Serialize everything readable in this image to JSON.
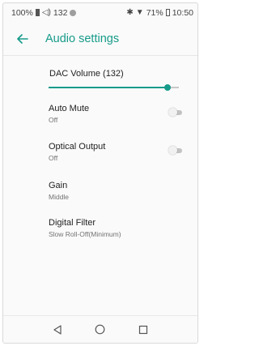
{
  "status_bar": {
    "battery_percent": "100%",
    "volume_value": "132",
    "battery_right": "71%",
    "time": "10:50",
    "icons": [
      "battery-icon",
      "speaker-icon",
      "circle-icon",
      "bluetooth-icon",
      "wifi-icon",
      "battery-icon"
    ]
  },
  "app_bar": {
    "back_icon": "arrow-left-icon",
    "title": "Audio settings"
  },
  "dac_volume": {
    "label": "DAC Volume (132)",
    "fraction": 0.91
  },
  "settings": [
    {
      "title": "Auto Mute",
      "value": "Off",
      "toggle": false
    },
    {
      "title": "Optical Output",
      "value": "Off",
      "toggle": false
    },
    {
      "title": "Gain",
      "value": "Middle"
    },
    {
      "title": "Digital Filter",
      "value": "Slow Roll-Off(Minimum)"
    }
  ],
  "nav_bar": {
    "icons": [
      "back-triangle-icon",
      "home-circle-icon",
      "recents-square-icon"
    ]
  },
  "colors": {
    "accent": "#169b8a",
    "subtitle": "#737373",
    "switch_track_off": "#c2c2c2"
  }
}
